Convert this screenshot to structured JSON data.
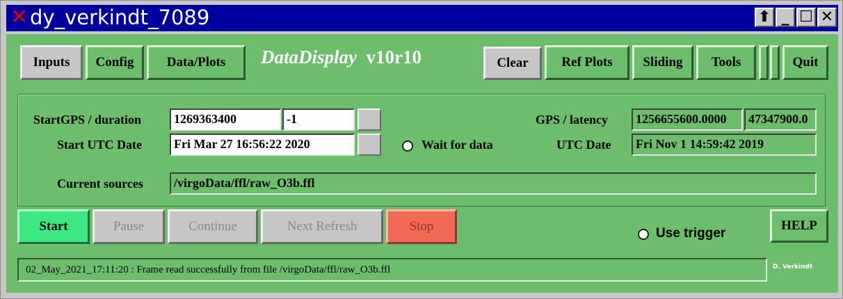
{
  "window": {
    "title": "dy_verkindt_7089",
    "controls": {
      "stick": "⬆",
      "minimize": "_",
      "maximize": "☐",
      "close": "✕"
    }
  },
  "toolbar": {
    "inputs": "Inputs",
    "config": "Config",
    "data_plots": "Data/Plots",
    "brand_name": "DataDisplay",
    "brand_version": "v10r10",
    "clear": "Clear",
    "ref_plots": "Ref Plots",
    "sliding": "Sliding",
    "tools": "Tools",
    "quit": "Quit"
  },
  "form": {
    "start_gps_label": "StartGPS / duration",
    "start_gps_value": "1269363400",
    "duration_value": "-1",
    "start_utc_label": "Start UTC Date",
    "start_utc_value": "Fri Mar 27 16:56:22 2020",
    "wait_for_data": "Wait for data",
    "gps_latency_label": "GPS / latency",
    "gps_value": "1256655600.0000",
    "latency_value": "47347900.0",
    "utc_date_label": "UTC Date",
    "utc_date_value": "Fri Nov  1 14:59:42 2019",
    "current_sources_label": "Current sources",
    "current_sources_value": "/virgoData/ffl/raw_O3b.ffl"
  },
  "controls": {
    "start": "Start",
    "pause": "Pause",
    "continue": "Continue",
    "next_refresh": "Next Refresh",
    "stop": "Stop",
    "use_trigger": "Use trigger",
    "help": "HELP"
  },
  "status": {
    "message": "02_May_2021_17:11:20 : Frame read successfully from file /virgoData/ffl/raw_O3b.ffl",
    "credit": "D. Verkindt"
  },
  "colors": {
    "panel": "#6cbd6c",
    "titlebar": "#0000a0",
    "start": "#3be882",
    "stop": "#f06a56"
  }
}
